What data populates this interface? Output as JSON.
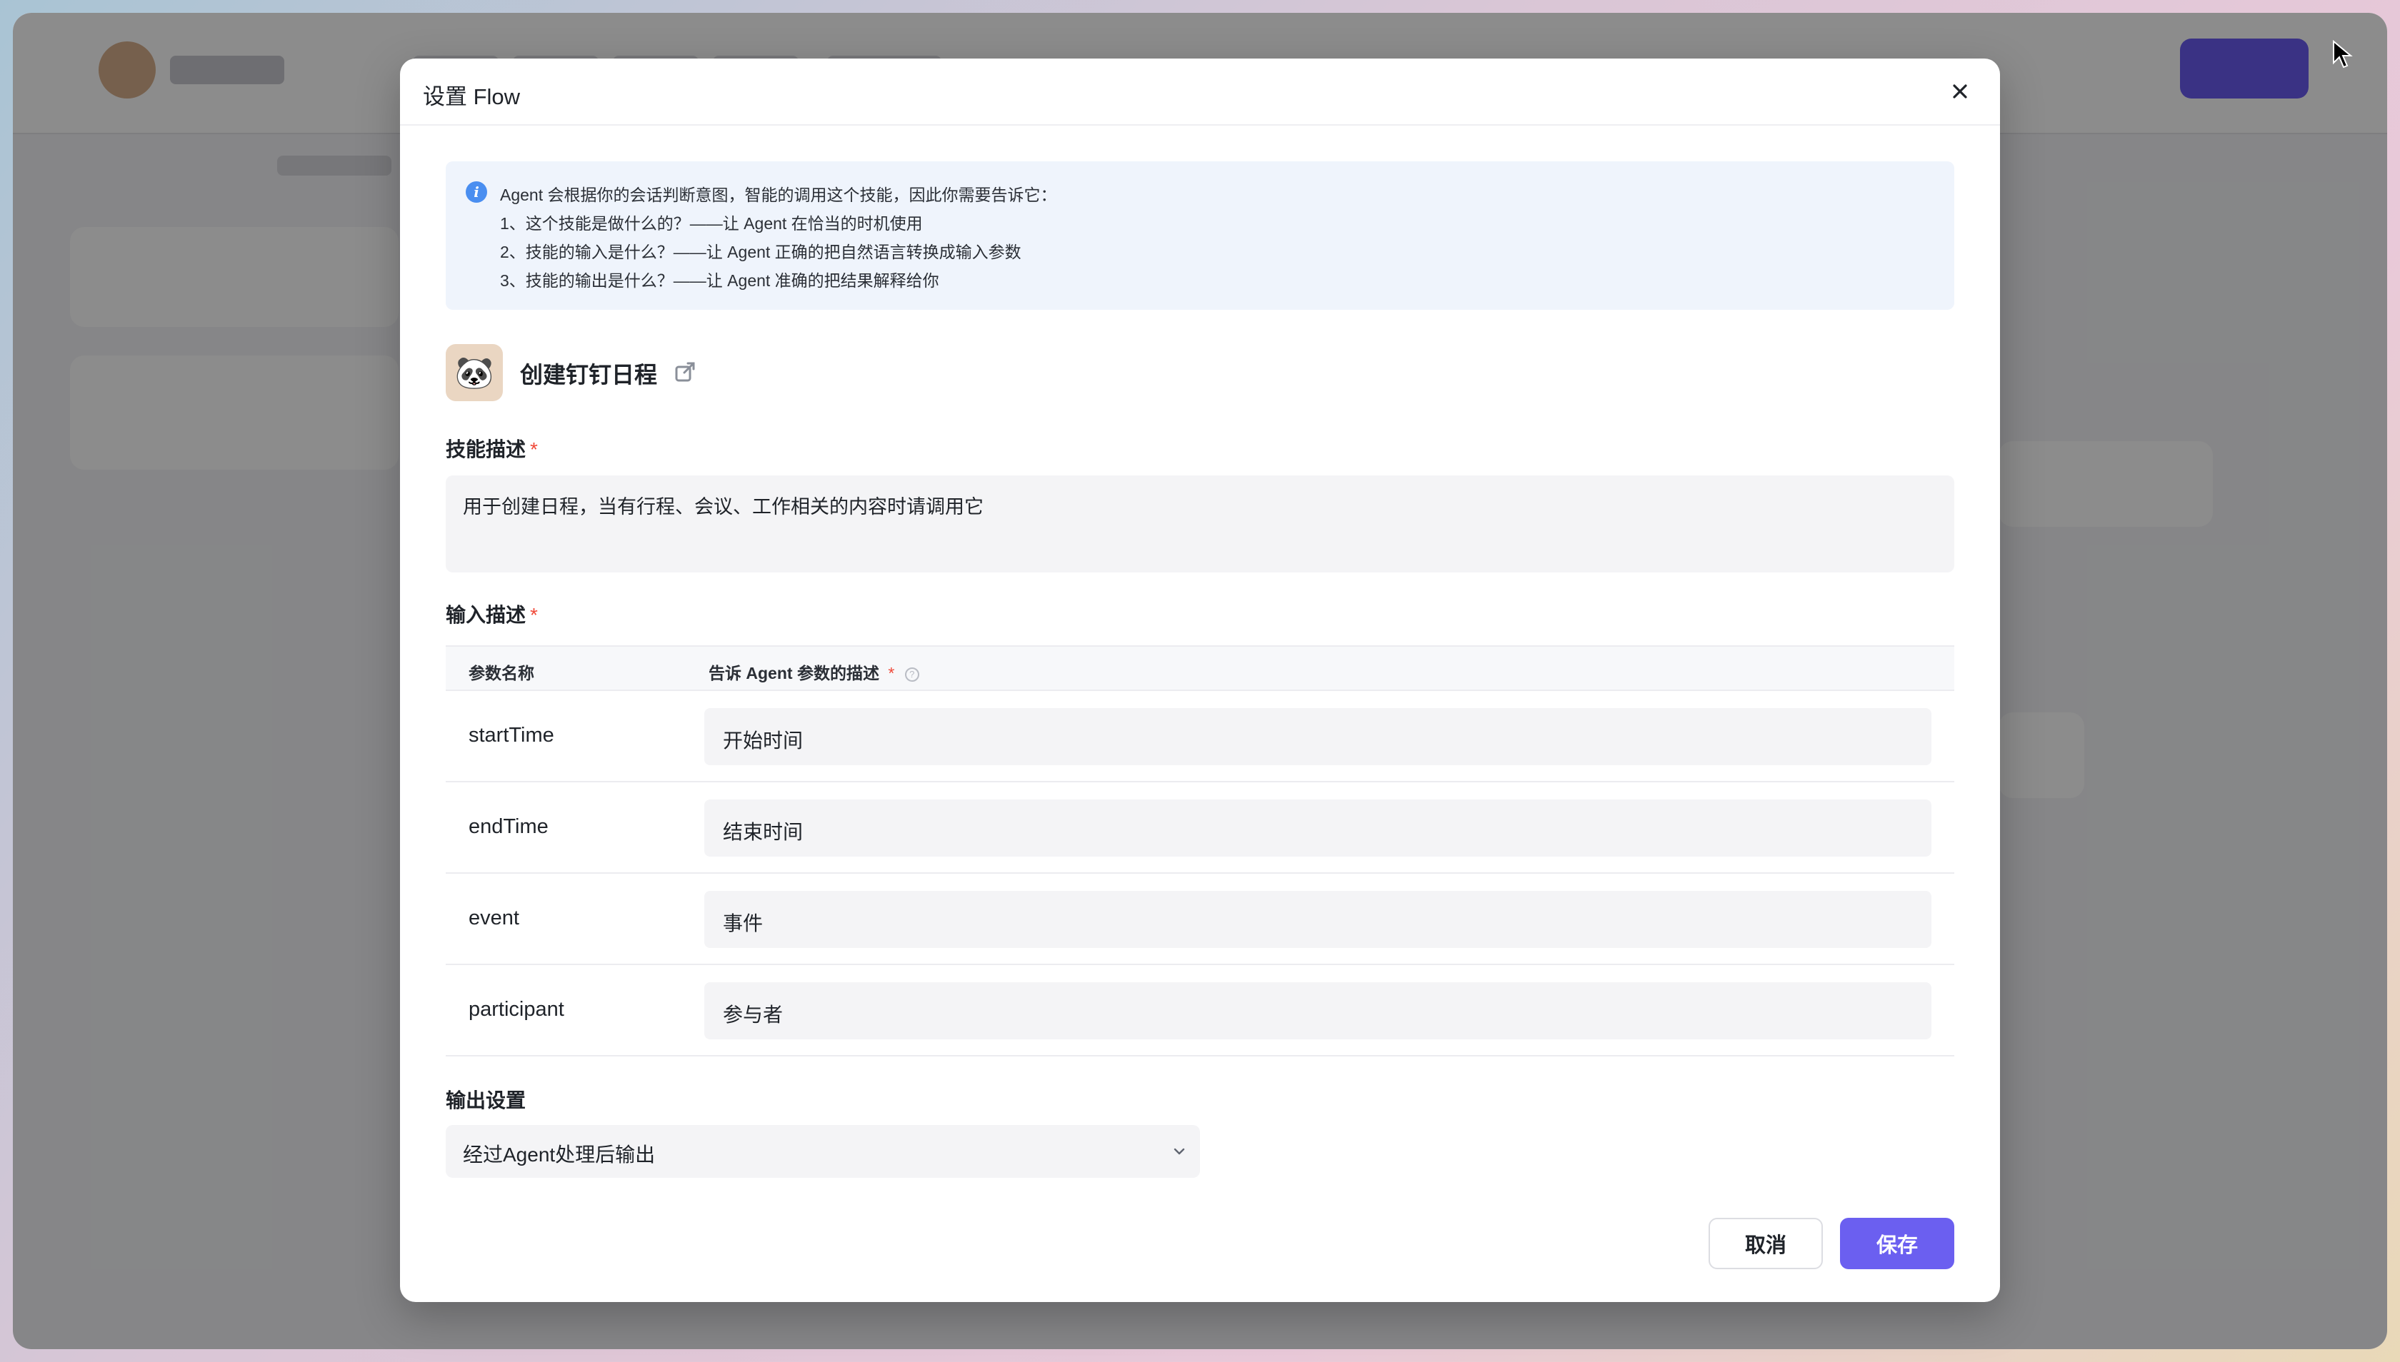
{
  "modal": {
    "title": "设置 Flow",
    "info": {
      "lines": [
        "Agent 会根据你的会话判断意图，智能的调用这个技能，因此你需要告诉它：",
        "1、这个技能是做什么的？——让 Agent 在恰当的时机使用",
        "2、技能的输入是什么？——让 Agent 正确的把自然语言转换成输入参数",
        "3、技能的输出是什么？——让 Agent 准确的把结果解释给你"
      ]
    },
    "skill": {
      "avatar": "panda-icon",
      "name": "创建钉钉日程"
    },
    "skill_description": {
      "label": "技能描述",
      "required_mark": "*",
      "value": "用于创建日程，当有行程、会议、工作相关的内容时请调用它"
    },
    "input_description": {
      "label": "输入描述",
      "required_mark": "*",
      "columns": {
        "name": "参数名称",
        "desc": "告诉 Agent 参数的描述",
        "desc_required_mark": "*"
      },
      "params": [
        {
          "name": "startTime",
          "desc": "开始时间"
        },
        {
          "name": "endTime",
          "desc": "结束时间"
        },
        {
          "name": "event",
          "desc": "事件"
        },
        {
          "name": "participant",
          "desc": "参与者"
        }
      ]
    },
    "output_settings": {
      "label": "输出设置",
      "selected": "经过Agent处理后输出"
    },
    "buttons": {
      "cancel": "取消",
      "save": "保存"
    }
  },
  "colors": {
    "accent": "#6b5ff0",
    "info_bg": "#eff4fc",
    "required": "#f04a3a"
  }
}
